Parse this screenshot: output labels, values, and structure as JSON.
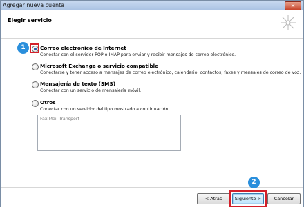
{
  "window": {
    "title": "Agregar nueva cuenta",
    "close_icon": "close-icon"
  },
  "header": {
    "title": "Elegir servicio",
    "decor_icon": "sparkle-icon"
  },
  "options": [
    {
      "label": "Correo electrónico de Internet",
      "description": "Conectar con el servidor POP o IMAP para enviar y recibir mensajes de correo electrónico.",
      "selected": true
    },
    {
      "label": "Microsoft Exchange o servicio compatible",
      "description": "Conectarse y tener acceso a mensajes de correo electrónico, calendario, contactos, faxes y mensajes de correo de voz.",
      "selected": false
    },
    {
      "label": "Mensajería de texto (SMS)",
      "description": "Conectar con un servicio de mensajería móvil.",
      "selected": false
    },
    {
      "label": "Otros",
      "description": "Conectar con un servidor del tipo mostrado a continuación.",
      "selected": false
    }
  ],
  "other_list": {
    "items": [
      "Fax Mail Transport"
    ]
  },
  "footer": {
    "back_label": "< Atrás",
    "next_label": "Siguiente >",
    "cancel_label": "Cancelar"
  },
  "annotations": {
    "step1": "1",
    "step2": "2",
    "badge_color": "#2a8fdc",
    "highlight_color": "#d3202a"
  }
}
